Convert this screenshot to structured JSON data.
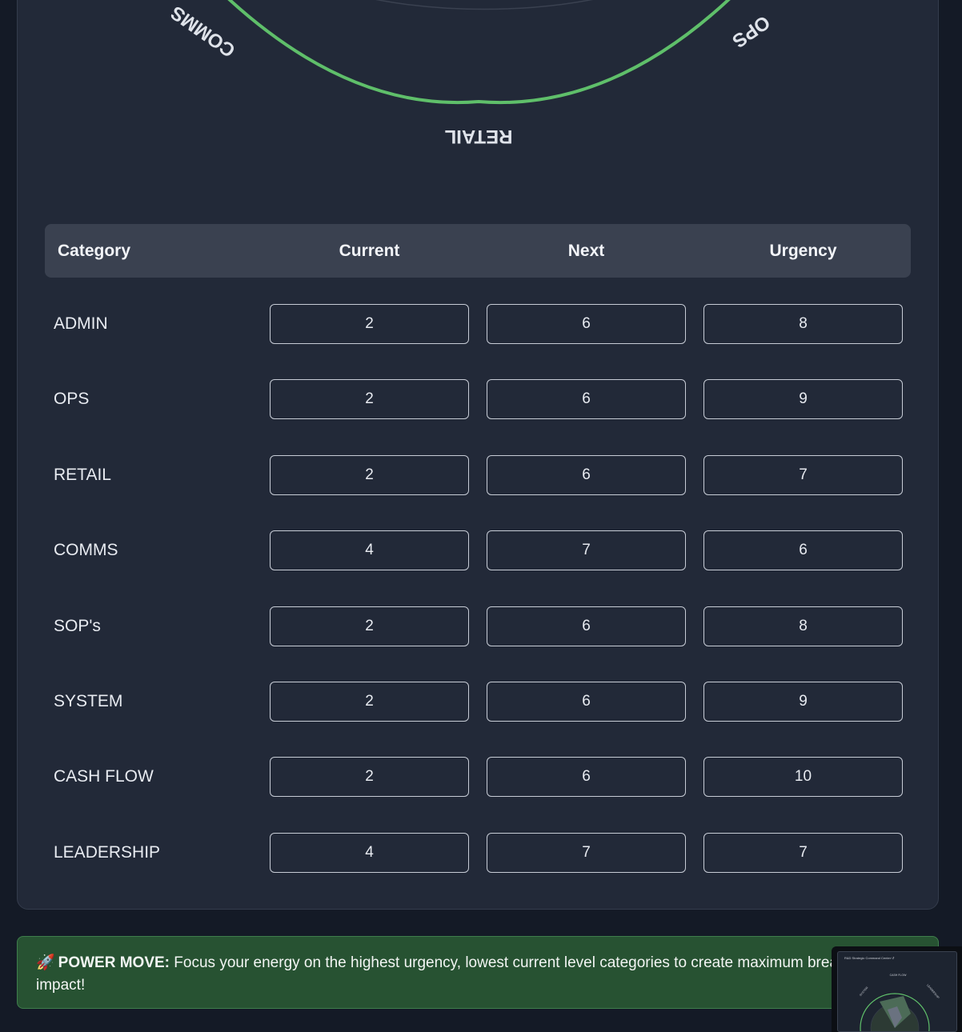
{
  "wheel": {
    "labels": {
      "comms": "COMMS",
      "ops": "OPS",
      "retail": "RETAIL"
    },
    "ring_color": "#5fbf6a"
  },
  "table": {
    "headers": {
      "category": "Category",
      "current": "Current",
      "next": "Next",
      "urgency": "Urgency"
    },
    "rows": [
      {
        "category": "ADMIN",
        "current": "2",
        "next": "6",
        "urgency": "8"
      },
      {
        "category": "OPS",
        "current": "2",
        "next": "6",
        "urgency": "9"
      },
      {
        "category": "RETAIL",
        "current": "2",
        "next": "6",
        "urgency": "7"
      },
      {
        "category": "COMMS",
        "current": "4",
        "next": "7",
        "urgency": "6"
      },
      {
        "category": "SOP's",
        "current": "2",
        "next": "6",
        "urgency": "8"
      },
      {
        "category": "SYSTEM",
        "current": "2",
        "next": "6",
        "urgency": "9"
      },
      {
        "category": "CASH FLOW",
        "current": "2",
        "next": "6",
        "urgency": "10"
      },
      {
        "category": "LEADERSHIP",
        "current": "4",
        "next": "7",
        "urgency": "7"
      }
    ]
  },
  "banner": {
    "icon": "rocket-icon",
    "emoji": "🚀",
    "label": "POWER MOVE:",
    "text": " Focus your energy on the highest urgency, lowest current level categories to create maximum breakthrough impact!"
  },
  "thumbnail": {
    "title": "R&D Strategic Command Center ↺",
    "labels": {
      "top": "CASH FLOW",
      "left": "SYSTEM",
      "right": "LEADERSHIP"
    }
  }
}
